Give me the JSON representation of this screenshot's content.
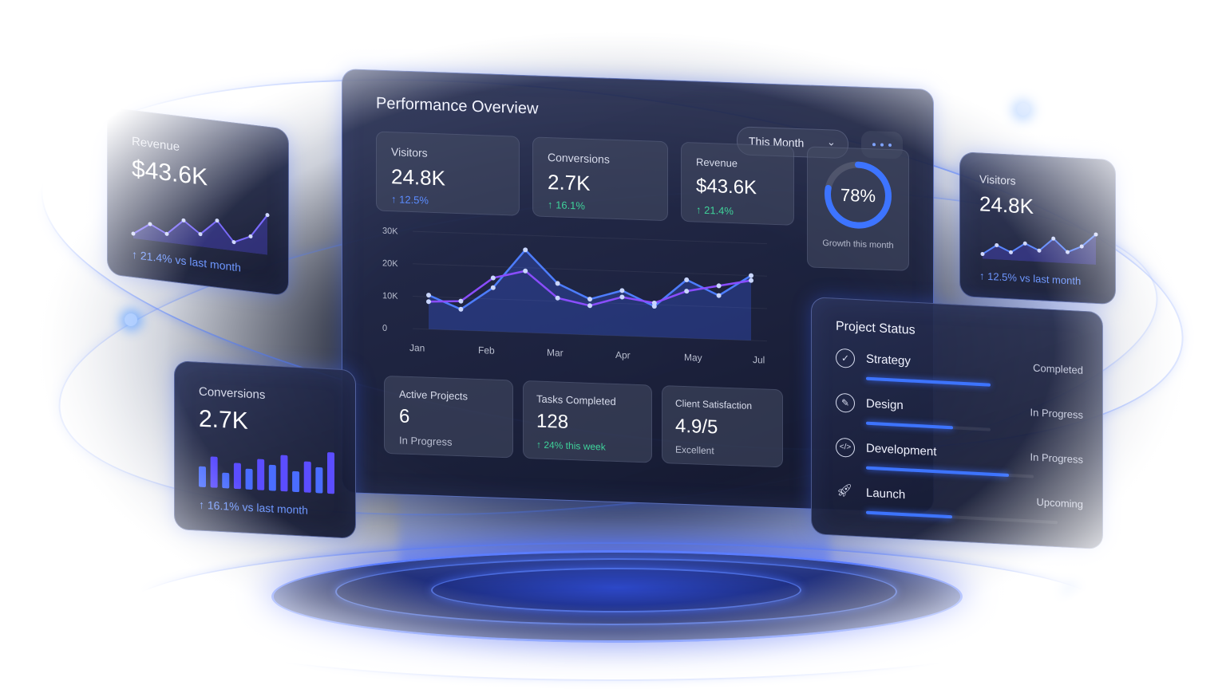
{
  "main": {
    "title": "Performance Overview",
    "period_select": "This Month",
    "kpis": [
      {
        "label": "Visitors",
        "value": "24.8K",
        "delta": "↑ 12.5%"
      },
      {
        "label": "Conversions",
        "value": "2.7K",
        "delta": "↑ 16.1%"
      },
      {
        "label": "Revenue",
        "value": "$43.6K",
        "delta": "↑ 21.4%"
      }
    ],
    "growth": {
      "value": "78%",
      "fraction": 0.78,
      "label": "Growth this month"
    },
    "bottom_stats": [
      {
        "label": "Active Projects",
        "value": "6",
        "sub": "In Progress"
      },
      {
        "label": "Tasks Completed",
        "value": "128",
        "sub": "↑ 24% this week"
      },
      {
        "label": "Client Satisfaction",
        "value": "4.9/5",
        "sub": "Excellent"
      }
    ]
  },
  "chart_data": {
    "type": "line",
    "x_ticks": [
      "Jan",
      "Feb",
      "Mar",
      "Apr",
      "May",
      "Jul"
    ],
    "y_ticks": [
      "0",
      "10K",
      "20K",
      "30K"
    ],
    "ylim": [
      0,
      30000
    ],
    "series": [
      {
        "values": [
          10500,
          6500,
          13500,
          25500,
          15500,
          11000,
          14000,
          9500,
          18000,
          13500,
          20000
        ]
      },
      {
        "values": [
          8500,
          9000,
          16500,
          19000,
          11000,
          9000,
          12000,
          10500,
          14500,
          16500,
          18500
        ]
      }
    ],
    "colors": {
      "series1": "#4d7dff",
      "series2": "#8a4dff"
    }
  },
  "left_revenue": {
    "label": "Revenue",
    "value": "$43.6K",
    "delta": "↑ 21.4% vs last month",
    "spark": [
      3,
      6,
      4,
      8,
      5,
      9,
      4,
      6,
      12
    ]
  },
  "left_conversions": {
    "label": "Conversions",
    "value": "2.7K",
    "delta": "↑ 16.1% vs last month",
    "bars": [
      4,
      6,
      3,
      5,
      4,
      6,
      5,
      7,
      4,
      6,
      5,
      8
    ]
  },
  "right_visitors": {
    "label": "Visitors",
    "value": "24.8K",
    "delta": "↑ 12.5% vs last month",
    "spark": [
      2,
      5,
      3,
      6,
      4,
      8,
      4,
      6,
      10
    ]
  },
  "project_status": {
    "title": "Project Status",
    "items": [
      {
        "name": "Strategy",
        "state": "Completed",
        "icon": "check-icon",
        "progress": 1.0
      },
      {
        "name": "Design",
        "state": "In Progress",
        "icon": "pencil-icon",
        "progress": 0.7
      },
      {
        "name": "Development",
        "state": "In Progress",
        "icon": "code-icon",
        "progress": 0.85
      },
      {
        "name": "Launch",
        "state": "Upcoming",
        "icon": "rocket-icon",
        "progress": 0.45
      }
    ]
  }
}
